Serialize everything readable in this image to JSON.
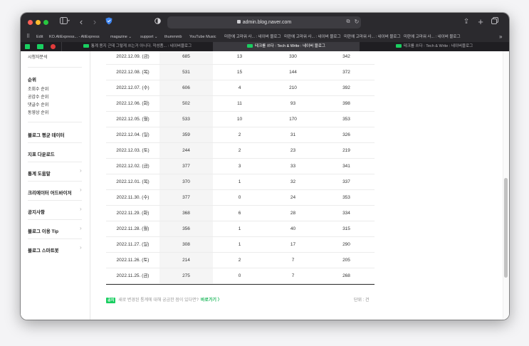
{
  "browser": {
    "url": "admin.blog.naver.com",
    "sidebar_toggle_icon": "sidebar-icon",
    "colors": {
      "close": "#ff5f57",
      "minimize": "#febc2e",
      "zoom": "#28c840",
      "naver_green": "#19ce60"
    }
  },
  "bookmarks": [
    "Edit",
    "KO.AliExpress... - AliExpress",
    "magazine ⌄",
    "support ⌄",
    "thummmb",
    "YouTube Music",
    "미란에 고마워 사... : 네이버 블로그",
    "미란에 고마워 사... : 네이버 블로그",
    "미란에 고마워 사... : 네이버 블로그",
    "미란에 고마워 사... : 네이버 블로그"
  ],
  "tabs": [
    {
      "label": "통계 용지 근데 그렇게 쓰는거 아니다. 작성품... : 네이버블로그",
      "active": false
    },
    {
      "label": "테크를 쓰다 : Tech & Write : 네이버 블로그",
      "active": true
    },
    {
      "label": "테크를 쓰다 : Tech & Write : 네이버블로그",
      "active": false
    }
  ],
  "sidebar": {
    "top_item": "시청자분석",
    "rank_title": "순위",
    "rank_items": [
      "조회수 순위",
      "공감수 순위",
      "댓글수 순위",
      "동영상 순위"
    ],
    "menus": [
      {
        "label": "블로그 평균 데이터",
        "chevron": false
      },
      {
        "label": "지표 다운로드",
        "chevron": false
      },
      {
        "label": "통계 도움말",
        "chevron": true
      },
      {
        "label": "크리에이터 어드바이저",
        "chevron": true
      },
      {
        "label": "공지사항",
        "chevron": true
      },
      {
        "label": "블로그 이용 Tip",
        "chevron": true
      },
      {
        "label": "블로그 스마트봇",
        "chevron": true
      }
    ]
  },
  "table": {
    "rows": [
      {
        "date": "2022.12.09. (금)",
        "v1": "685",
        "v2": "13",
        "v3": "330",
        "v4": "342"
      },
      {
        "date": "2022.12.08. (목)",
        "v1": "531",
        "v2": "15",
        "v3": "144",
        "v4": "372"
      },
      {
        "date": "2022.12.07. (수)",
        "v1": "606",
        "v2": "4",
        "v3": "210",
        "v4": "392"
      },
      {
        "date": "2022.12.06. (화)",
        "v1": "502",
        "v2": "11",
        "v3": "93",
        "v4": "398"
      },
      {
        "date": "2022.12.05. (월)",
        "v1": "533",
        "v2": "10",
        "v3": "170",
        "v4": "353"
      },
      {
        "date": "2022.12.04. (일)",
        "v1": "359",
        "v2": "2",
        "v3": "31",
        "v4": "326"
      },
      {
        "date": "2022.12.03. (토)",
        "v1": "244",
        "v2": "2",
        "v3": "23",
        "v4": "219"
      },
      {
        "date": "2022.12.02. (금)",
        "v1": "377",
        "v2": "3",
        "v3": "33",
        "v4": "341"
      },
      {
        "date": "2022.12.01. (목)",
        "v1": "370",
        "v2": "1",
        "v3": "32",
        "v4": "337"
      },
      {
        "date": "2022.11.30. (수)",
        "v1": "377",
        "v2": "0",
        "v3": "24",
        "v4": "353"
      },
      {
        "date": "2022.11.29. (화)",
        "v1": "368",
        "v2": "6",
        "v3": "28",
        "v4": "334"
      },
      {
        "date": "2022.11.28. (월)",
        "v1": "356",
        "v2": "1",
        "v3": "40",
        "v4": "315"
      },
      {
        "date": "2022.11.27. (일)",
        "v1": "308",
        "v2": "1",
        "v3": "17",
        "v4": "290"
      },
      {
        "date": "2022.11.26. (토)",
        "v1": "214",
        "v2": "2",
        "v3": "7",
        "v4": "205"
      },
      {
        "date": "2022.11.25. (금)",
        "v1": "275",
        "v2": "0",
        "v3": "7",
        "v4": "268"
      }
    ]
  },
  "notice": {
    "badge": "공지",
    "text": "새로 변경된 통계에 대해 궁금한 점이 있다면?",
    "link": "바로가기 〉",
    "unit": "단위 : 건"
  }
}
